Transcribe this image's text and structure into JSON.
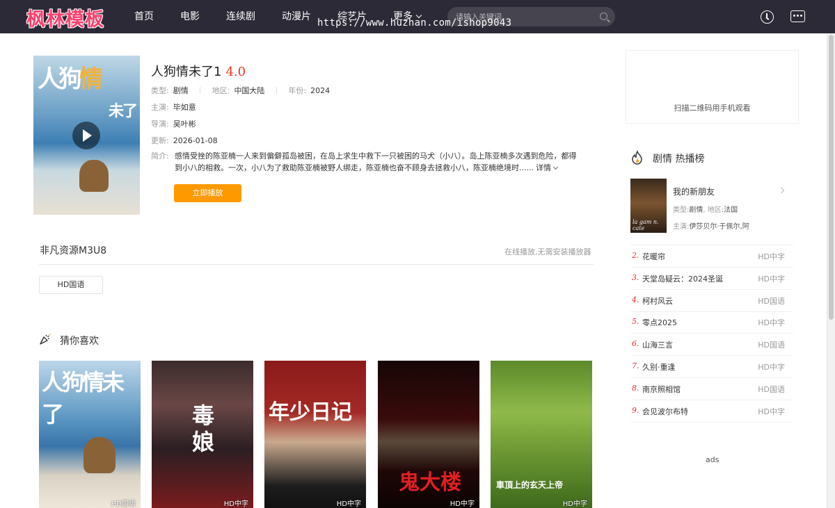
{
  "header": {
    "logo": "枫林模板",
    "nav": [
      "首页",
      "电影",
      "连续剧",
      "动漫片",
      "综艺片",
      "更多"
    ],
    "search_placeholder": "请输入关键词",
    "watermark": "https://www.huzhan.com/ishop9043"
  },
  "detail": {
    "title": "人狗情未了1",
    "score": "4.0",
    "type_label": "类型:",
    "type": "剧情",
    "region_label": "地区:",
    "region": "中国大陆",
    "year_label": "年份:",
    "year": "2024",
    "actors_label": "主演:",
    "actors": "毕如意",
    "director_label": "导演:",
    "director": "吴叶彬",
    "updated_label": "更新:",
    "updated": "2026-01-08",
    "intro_label": "简介:",
    "intro_line1": "感情受挫的陈亚楠一人来到偏僻孤岛被困，在岛上求生中救下一只被困的马犬（小八）。岛上陈亚楠多次遇到危险，都得",
    "intro_line2": "到小八的相救。一次，小八为了救助陈亚楠被野人绑走，陈亚楠也奋不顾身去拯救小八，陈亚楠绝境时......",
    "detail_link": "详情",
    "play_button": "立即播放",
    "poster_text_a": "人狗",
    "poster_text_b": "情",
    "poster_text_c": "未了"
  },
  "source": {
    "title": "非凡资源M3U8",
    "note": "在线播放,无需安装播放器",
    "episodes": [
      "HD国语"
    ]
  },
  "guess": {
    "title": "猜你喜欢",
    "items": [
      {
        "badge": "HD国语",
        "poster_text": "人狗情未了"
      },
      {
        "badge": "HD中字",
        "poster_text": "毒娘"
      },
      {
        "badge": "HD中字",
        "poster_text": "年少日记"
      },
      {
        "badge": "HD中字",
        "poster_text": "鬼大楼"
      },
      {
        "badge": "HD中字",
        "poster_text": "車頂上的玄天上帝"
      }
    ]
  },
  "sidebar": {
    "qr_text": "扫描二维码用手机观看",
    "hot_title": "剧情 热播榜",
    "top": {
      "name": "我的新朋友",
      "type_label": "类型:",
      "type": "剧情",
      "region_label": "地区:",
      "region": "法国",
      "actors_label": "主演:",
      "actors": "伊莎贝尔·于佩尔,阿",
      "thumb_text": "la gam n. cate"
    },
    "ranks": [
      {
        "num": "2.",
        "name": "花暖帘",
        "tag": "HD中字"
      },
      {
        "num": "3.",
        "name": "天堂岛疑云：2024圣诞",
        "tag": "HD中字"
      },
      {
        "num": "4.",
        "name": "柯村风云",
        "tag": "HD国语"
      },
      {
        "num": "5.",
        "name": "零点2025",
        "tag": "HD中字"
      },
      {
        "num": "6.",
        "name": "山海三言",
        "tag": "HD国语"
      },
      {
        "num": "7.",
        "name": "久别·重逢",
        "tag": "HD中字"
      },
      {
        "num": "8.",
        "name": "南京照相馆",
        "tag": "HD国语"
      },
      {
        "num": "9.",
        "name": "会见波尔布特",
        "tag": "HD中字"
      }
    ],
    "ads": "ads"
  },
  "colors": {
    "header_bg": "#2b2a36",
    "logo": "#ff3f6e",
    "score": "#ee3322",
    "play_button": "#ff9900",
    "rank_number": "#e0322f"
  },
  "icons": [
    "search-icon",
    "history-icon",
    "message-icon",
    "play-icon",
    "guess-icon",
    "fire-icon",
    "chevron-right-icon",
    "chevron-down-icon"
  ]
}
